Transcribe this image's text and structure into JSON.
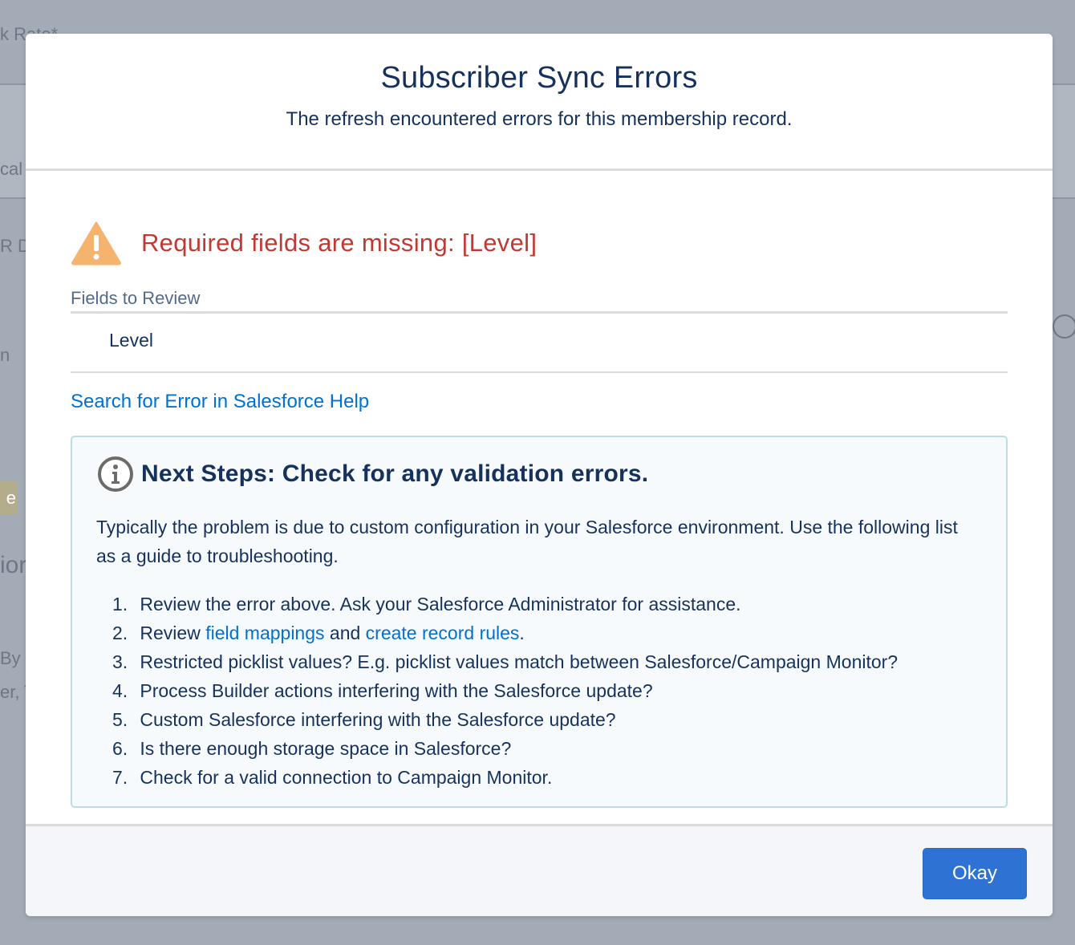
{
  "background": {
    "fragments": [
      "k Rate*",
      "cal",
      "R D",
      "n",
      "e",
      "ior",
      "By",
      "er, T"
    ]
  },
  "modal": {
    "title": "Subscriber Sync Errors",
    "subtitle": "The refresh encountered errors for this membership record.",
    "error_message": "Required fields are missing: [Level]",
    "fields_label": "Fields to Review",
    "fields": [
      "Level"
    ],
    "help_link": "Search for Error in Salesforce Help",
    "next_steps": {
      "title": "Next Steps: Check for any validation errors.",
      "description": "Typically the problem is due to custom configuration in your Salesforce environment. Use the following list as a guide to troubleshooting.",
      "steps": [
        {
          "num": "1.",
          "text": "Review the error above. Ask your Salesforce Administrator for assistance."
        },
        {
          "num": "2.",
          "pre": "Review ",
          "link1": "field mappings",
          "mid": " and ",
          "link2": "create record rules",
          "post": "."
        },
        {
          "num": "3.",
          "text": "Restricted picklist values? E.g. picklist values match between Salesforce/Campaign Monitor?"
        },
        {
          "num": "4.",
          "text": "Process Builder actions interfering with the Salesforce update?"
        },
        {
          "num": "5.",
          "text": "Custom Salesforce interfering with the Salesforce update?"
        },
        {
          "num": "6.",
          "text": "Is there enough storage space in Salesforce?"
        },
        {
          "num": "7.",
          "text": "Check for a valid connection to Campaign Monitor."
        }
      ]
    },
    "okay_label": "Okay"
  },
  "icons": {
    "warning": "warning-icon",
    "info": "info-icon"
  },
  "colors": {
    "error": "#c23934",
    "link": "#0070d2",
    "primary_button": "#2e73d4",
    "warning": "#f4b46d",
    "text": "#16325c"
  }
}
